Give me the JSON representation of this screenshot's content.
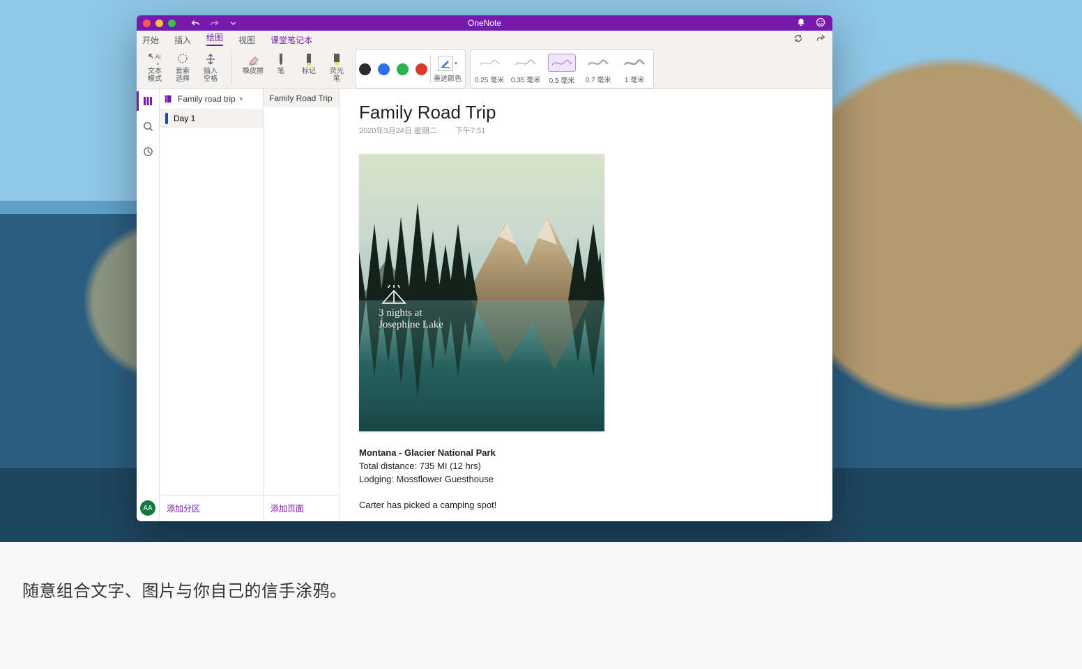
{
  "app": {
    "title": "OneNote"
  },
  "titlebar": {
    "avatar_initials": "AA"
  },
  "tabs": {
    "items": [
      "开始",
      "插入",
      "绘图",
      "视图",
      "课堂笔记本"
    ],
    "active_index": 2
  },
  "ribbon": {
    "text_mode": "文本\n模式",
    "lasso": "套索\n选择",
    "insert_space": "插入\n空格",
    "eraser": "橡皮擦",
    "pen": "笔",
    "marker": "标记",
    "highlighter": "荧光\n笔",
    "ink_color": "墨迹颜色",
    "thickness": [
      "0.25 毫米",
      "0.35 毫米",
      "0.5 毫米",
      "0.7 毫米",
      "1 毫米"
    ],
    "active_thickness_index": 2
  },
  "notebook": {
    "name": "Family road trip",
    "section": {
      "name": "Day 1"
    },
    "page_list_item": "Family Road Trip",
    "add_section": "添加分区",
    "add_page": "添加页面"
  },
  "page": {
    "title": "Family Road Trip",
    "date": "2020年3月24日 星期二",
    "time": "下午7:51",
    "ink_lines": [
      "3 nights at",
      "Josephine Lake"
    ],
    "heading": "Montana - Glacier National Park",
    "line1": "Total distance: 735 MI (12 hrs)",
    "line2": "Lodging: Mossflower Guesthouse",
    "line3": "Carter has picked a camping spot!"
  },
  "caption": "随意组合文字、图片与你自己的信手涂鸦。"
}
